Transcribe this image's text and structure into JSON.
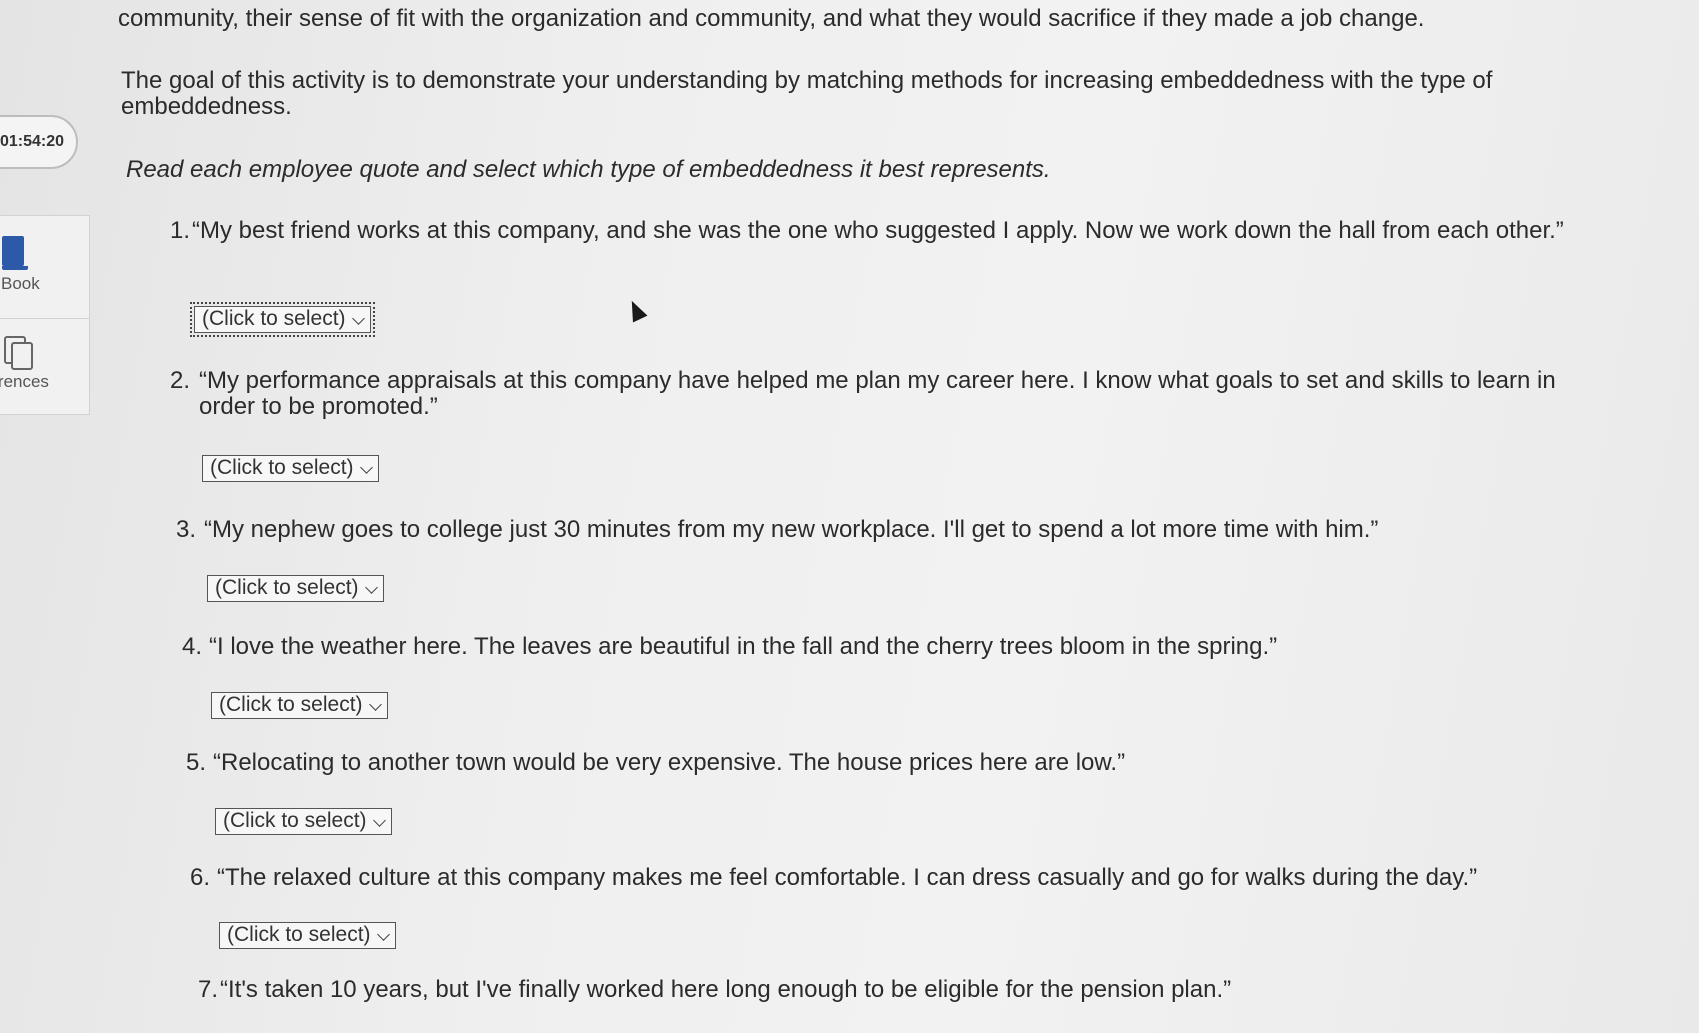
{
  "timer": {
    "text": "01:54:20"
  },
  "sidebar": {
    "items": [
      {
        "label": "Book",
        "icon": "book-icon"
      },
      {
        "label": "References",
        "icon": "references-icon"
      }
    ]
  },
  "content": {
    "intro_line": "community, their sense of fit with the organization and community, and what they would sacrifice if they made a job change.",
    "goal_line1": "The goal of this activity is to demonstrate your understanding by matching methods for increasing embeddedness with the type of",
    "goal_line2": "embeddedness.",
    "instruction": "Read each employee quote and select which type of embeddedness it best represents."
  },
  "questions": [
    {
      "num": "1.",
      "text": "“My best friend works at this company, and she was the one who suggested I apply. Now we work down the hall from each other.”",
      "select": "(Click to select)"
    },
    {
      "num": "2.",
      "text": "“My performance appraisals at this company have helped me plan my career here. I know what goals to set and skills to learn in order to be promoted.”",
      "select": "(Click to select)"
    },
    {
      "num": "3.",
      "text": "“My nephew goes to college just 30 minutes from my new workplace. I'll get to spend a lot more time with him.”",
      "select": "(Click to select)"
    },
    {
      "num": "4.",
      "text": "“I love the weather here. The leaves are beautiful in the fall and the cherry trees bloom in the spring.”",
      "select": "(Click to select)"
    },
    {
      "num": "5.",
      "text": "“Relocating to another town would be very expensive. The house prices here are low.”",
      "select": "(Click to select)"
    },
    {
      "num": "6.",
      "text": "“The relaxed culture at this company makes me feel comfortable. I can dress casually and go for walks during the day.”",
      "select": "(Click to select)"
    },
    {
      "num": "7.",
      "text": "“It's taken 10 years, but I've finally worked here long enough to be eligible for the pension plan.”"
    }
  ]
}
